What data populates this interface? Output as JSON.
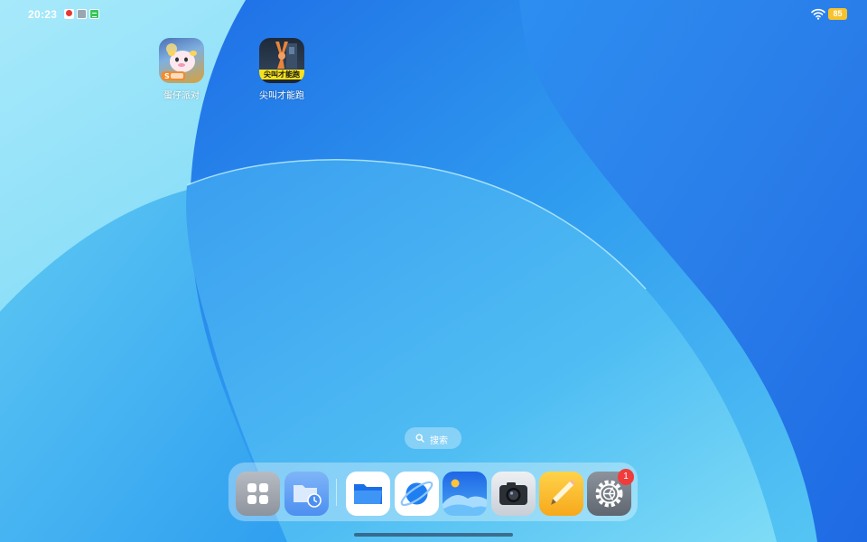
{
  "status_bar": {
    "time": "20:23",
    "battery": "85",
    "notification_icons": [
      "weibo-notification-icon",
      "app-notification-icon",
      "message-notification-icon"
    ],
    "wifi_icon": "wifi-icon"
  },
  "home_apps": [
    {
      "label": "蛋仔派对",
      "icon": "eggy-party-app-icon"
    },
    {
      "label": "尖叫才能跑",
      "icon": "scream-run-app-icon",
      "icon_text": "尖叫才能跑"
    }
  ],
  "search": {
    "label": "搜索",
    "icon": "search-icon"
  },
  "dock": {
    "apps": [
      {
        "name": "app-drawer",
        "icon": "grid-icon"
      },
      {
        "name": "recent-files",
        "icon": "folder-clock-icon"
      },
      {
        "name": "files",
        "icon": "folder-icon"
      },
      {
        "name": "browser",
        "icon": "planet-icon"
      },
      {
        "name": "gallery",
        "icon": "photo-icon"
      },
      {
        "name": "camera",
        "icon": "camera-icon"
      },
      {
        "name": "notes",
        "icon": "pencil-icon"
      },
      {
        "name": "settings",
        "icon": "gear-icon"
      }
    ],
    "settings_badge": "1"
  },
  "colors": {
    "wallpaper_light": "#8ddff4",
    "wallpaper_mid": "#3fb4ef",
    "wallpaper_deep": "#1f78e8",
    "badge": "#f23b3b",
    "battery": "#f7c22b"
  }
}
